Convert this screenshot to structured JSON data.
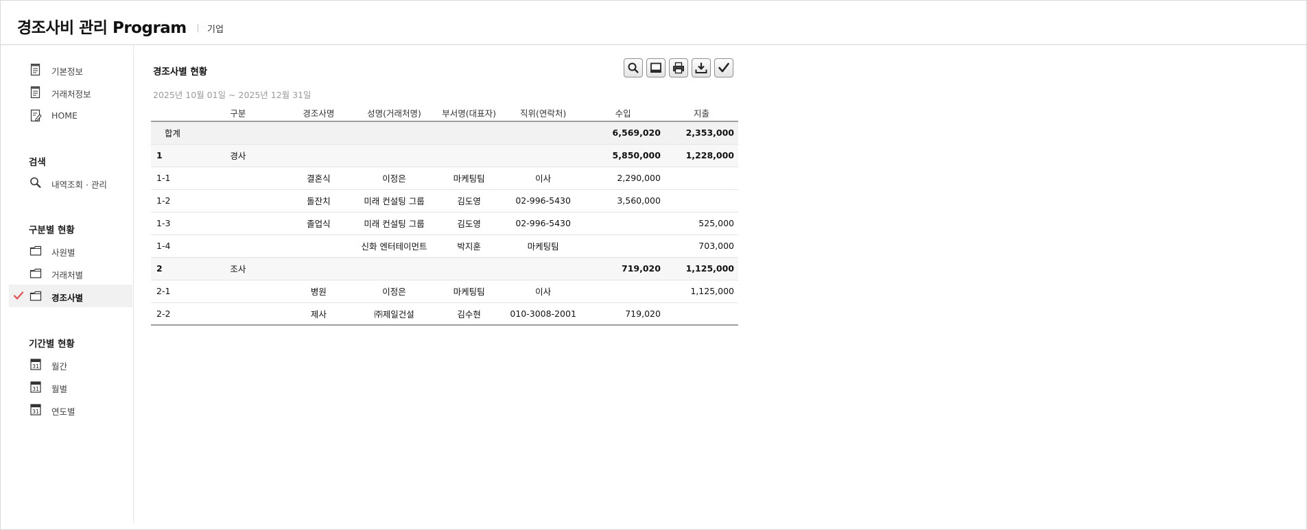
{
  "header": {
    "title": "경조사비 관리 Program",
    "subtitle": "기업"
  },
  "sidebar": {
    "top_items": [
      {
        "label": "기본정보",
        "icon": "document-icon"
      },
      {
        "label": "거래처정보",
        "icon": "document-icon"
      },
      {
        "label": "HOME",
        "icon": "edit-document-icon"
      }
    ],
    "search_heading": "검색",
    "search_items": [
      {
        "label": "내역조회 · 관리",
        "icon": "search-icon"
      }
    ],
    "category_heading": "구분별 현황",
    "category_items": [
      {
        "label": "사원별",
        "icon": "folder-icon"
      },
      {
        "label": "거래처별",
        "icon": "folder-icon"
      },
      {
        "label": "경조사별",
        "icon": "folder-icon",
        "active": true
      }
    ],
    "period_heading": "기간별 현황",
    "period_items": [
      {
        "label": "월간",
        "icon": "calendar-icon"
      },
      {
        "label": "월별",
        "icon": "calendar-icon"
      },
      {
        "label": "연도별",
        "icon": "calendar-icon"
      }
    ],
    "calendar_day": "31"
  },
  "main": {
    "title": "경조사별 현황",
    "period": "2025년 10월 01일 ~ 2025년 12월 31일",
    "toolbar": [
      "search-icon",
      "monitor-icon",
      "printer-icon",
      "download-icon",
      "check-icon"
    ],
    "columns": [
      "",
      "구분",
      "경조사명",
      "성명(거래처명)",
      "부서명(대표자)",
      "직위(연락처)",
      "수입",
      "지출"
    ],
    "summary": {
      "label": "합계",
      "income": "6,569,020",
      "expense": "2,353,000"
    },
    "groups": [
      {
        "no": "1",
        "category": "경사",
        "income": "5,850,000",
        "expense": "1,228,000",
        "rows": [
          {
            "no": "1-1",
            "event": "결혼식",
            "name": "이정은",
            "dept": "마케팅팀",
            "position": "이사",
            "income": "2,290,000",
            "expense": ""
          },
          {
            "no": "1-2",
            "event": "돌잔치",
            "name": "미래 컨설팅 그룹",
            "dept": "김도영",
            "position": "02-996-5430",
            "income": "3,560,000",
            "expense": ""
          },
          {
            "no": "1-3",
            "event": "졸업식",
            "name": "미래 컨설팅 그룹",
            "dept": "김도영",
            "position": "02-996-5430",
            "income": "",
            "expense": "525,000"
          },
          {
            "no": "1-4",
            "event": "",
            "name": "신화 엔터테이먼트",
            "dept": "박지훈",
            "position": "마케팅팀",
            "income": "",
            "expense": "703,000"
          }
        ]
      },
      {
        "no": "2",
        "category": "조사",
        "income": "719,020",
        "expense": "1,125,000",
        "rows": [
          {
            "no": "2-1",
            "event": "병원",
            "name": "이정은",
            "dept": "마케팅팀",
            "position": "이사",
            "income": "",
            "expense": "1,125,000"
          },
          {
            "no": "2-2",
            "event": "제사",
            "name": "㈜제일건설",
            "dept": "김수현",
            "position": "010-3008-2001",
            "income": "719,020",
            "expense": ""
          }
        ]
      }
    ],
    "colors": {
      "income": "#e67e22",
      "expense": "#3aaee3",
      "check": "#e05858"
    }
  }
}
